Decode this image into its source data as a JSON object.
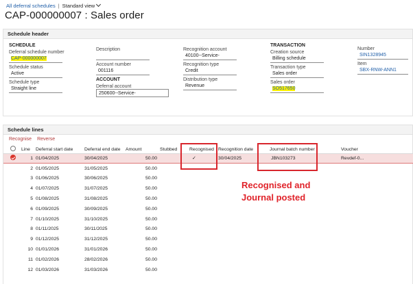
{
  "breadcrumb": {
    "link": "All deferral schedules",
    "separator": "|",
    "view": "Standard view"
  },
  "page_title": "CAP-000000007 : Sales order",
  "header": {
    "section_title": "Schedule header",
    "schedule": {
      "group": "SCHEDULE",
      "deferral_number_label": "Deferral schedule number",
      "deferral_number_value": "CAP-000000007",
      "status_label": "Schedule status",
      "status_value": "Active",
      "type_label": "Schedule type",
      "type_value": "Straight line"
    },
    "desc": {
      "description_label": "Description",
      "description_value": "",
      "account_number_label": "Account number",
      "account_number_value": "001116",
      "account_group": "ACCOUNT",
      "deferral_account_label": "Deferral account",
      "deferral_account_value": "250600--Service-"
    },
    "recognition": {
      "recognition_account_label": "Recognition account",
      "recognition_account_value": "40100--Service-",
      "recognition_type_label": "Recognition type",
      "recognition_type_value": "Credit",
      "distribution_type_label": "Distribution type",
      "distribution_type_value": "Revenue"
    },
    "transaction": {
      "group": "TRANSACTION",
      "creation_source_label": "Creation source",
      "creation_source_value": "Billing schedule",
      "transaction_type_label": "Transaction type",
      "transaction_type_value": "Sales order",
      "sales_order_label": "Sales order",
      "sales_order_value": "SO517650"
    },
    "number": {
      "number_label": "Number",
      "number_value": "SIN1328945",
      "item_label": "Item",
      "item_value": "SBX-RNW-ANN1"
    }
  },
  "lines": {
    "section_title": "Schedule lines",
    "actions": [
      "Recognise",
      "Reverse"
    ],
    "columns": [
      "Line",
      "Deferral start date",
      "Deferral end date",
      "Amount",
      "Stubbed",
      "Recognised",
      "Recognition date",
      "Journal batch number",
      "Voucher"
    ],
    "rows": [
      {
        "line": "1",
        "start": "01/04/2025",
        "end": "30/04/2025",
        "amount": "50.00",
        "stubbed": "",
        "recognised": "✓",
        "rec_date": "30/04/2025",
        "batch": "JBN103273",
        "voucher": "Revdef-0..."
      },
      {
        "line": "2",
        "start": "01/05/2025",
        "end": "31/05/2025",
        "amount": "50.00",
        "stubbed": "",
        "recognised": "",
        "rec_date": "",
        "batch": "",
        "voucher": ""
      },
      {
        "line": "3",
        "start": "01/06/2025",
        "end": "30/06/2025",
        "amount": "50.00",
        "stubbed": "",
        "recognised": "",
        "rec_date": "",
        "batch": "",
        "voucher": ""
      },
      {
        "line": "4",
        "start": "01/07/2025",
        "end": "31/07/2025",
        "amount": "50.00",
        "stubbed": "",
        "recognised": "",
        "rec_date": "",
        "batch": "",
        "voucher": ""
      },
      {
        "line": "5",
        "start": "01/08/2025",
        "end": "31/08/2025",
        "amount": "50.00",
        "stubbed": "",
        "recognised": "",
        "rec_date": "",
        "batch": "",
        "voucher": ""
      },
      {
        "line": "6",
        "start": "01/09/2025",
        "end": "30/09/2025",
        "amount": "50.00",
        "stubbed": "",
        "recognised": "",
        "rec_date": "",
        "batch": "",
        "voucher": ""
      },
      {
        "line": "7",
        "start": "01/10/2025",
        "end": "31/10/2025",
        "amount": "50.00",
        "stubbed": "",
        "recognised": "",
        "rec_date": "",
        "batch": "",
        "voucher": ""
      },
      {
        "line": "8",
        "start": "01/11/2025",
        "end": "30/11/2025",
        "amount": "50.00",
        "stubbed": "",
        "recognised": "",
        "rec_date": "",
        "batch": "",
        "voucher": ""
      },
      {
        "line": "9",
        "start": "01/12/2025",
        "end": "31/12/2025",
        "amount": "50.00",
        "stubbed": "",
        "recognised": "",
        "rec_date": "",
        "batch": "",
        "voucher": ""
      },
      {
        "line": "10",
        "start": "01/01/2026",
        "end": "31/01/2026",
        "amount": "50.00",
        "stubbed": "",
        "recognised": "",
        "rec_date": "",
        "batch": "",
        "voucher": ""
      },
      {
        "line": "11",
        "start": "01/02/2026",
        "end": "28/02/2026",
        "amount": "50.00",
        "stubbed": "",
        "recognised": "",
        "rec_date": "",
        "batch": "",
        "voucher": ""
      },
      {
        "line": "12",
        "start": "01/03/2026",
        "end": "31/03/2026",
        "amount": "50.00",
        "stubbed": "",
        "recognised": "",
        "rec_date": "",
        "batch": "",
        "voucher": ""
      }
    ]
  },
  "annotation": {
    "line1": "Recognised and",
    "line2": "Journal posted",
    "color": "#e0232a"
  },
  "colors": {
    "link": "#1f5ea8",
    "highlight": "#fff200",
    "selected_row": "#f6dede",
    "accent": "#d9342b"
  }
}
